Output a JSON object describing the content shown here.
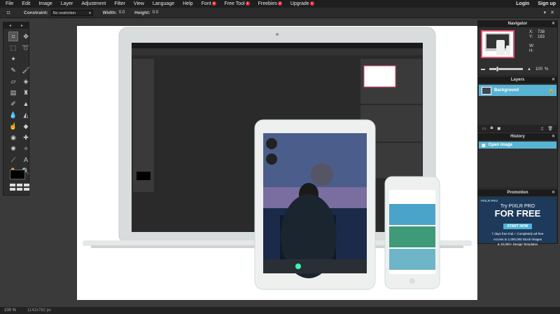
{
  "menu": {
    "items": [
      {
        "label": "File"
      },
      {
        "label": "Edit"
      },
      {
        "label": "Image"
      },
      {
        "label": "Layer"
      },
      {
        "label": "Adjustment"
      },
      {
        "label": "Filter"
      },
      {
        "label": "View"
      },
      {
        "label": "Language"
      },
      {
        "label": "Help"
      },
      {
        "label": "Font",
        "badge": "4"
      },
      {
        "label": "Free Tool",
        "badge": "1"
      },
      {
        "label": "Freebies",
        "badge": "2"
      },
      {
        "label": "Upgrade",
        "badge": "1"
      }
    ],
    "login": "Login",
    "signup": "Sign up"
  },
  "options": {
    "constraint_label": "Constraint:",
    "constraint_value": "No restriction",
    "width_label": "Width:",
    "width_value": "0.0",
    "height_label": "Height:",
    "height_value": "0.0"
  },
  "navigator": {
    "title": "Navigator",
    "x_label": "X:",
    "x_value": "738",
    "y_label": "Y:",
    "y_value": "183",
    "w_label": "W:",
    "h_label": "H:",
    "zoom": "100",
    "zoom_unit": "%"
  },
  "layers": {
    "title": "Layers",
    "items": [
      {
        "name": "Background"
      }
    ]
  },
  "history": {
    "title": "History",
    "items": [
      {
        "name": "Open image"
      }
    ]
  },
  "promotion": {
    "title": "Promotion",
    "brand": "PIXLR PRO",
    "line1": "Try PIXLR PRO",
    "line2": "FOR FREE",
    "button": "START NOW",
    "text1": "7 days free trial + Completely ad-free",
    "text2": "Access to 1,000,000 Stock Images",
    "text3": "& 10,000+ Design Templates"
  },
  "status": {
    "zoom": "100 %",
    "size": "1142x782 px"
  },
  "colors": {
    "accent": "#59b4d3",
    "badge": "#e03030",
    "nav_frame": "#e34f6e"
  }
}
